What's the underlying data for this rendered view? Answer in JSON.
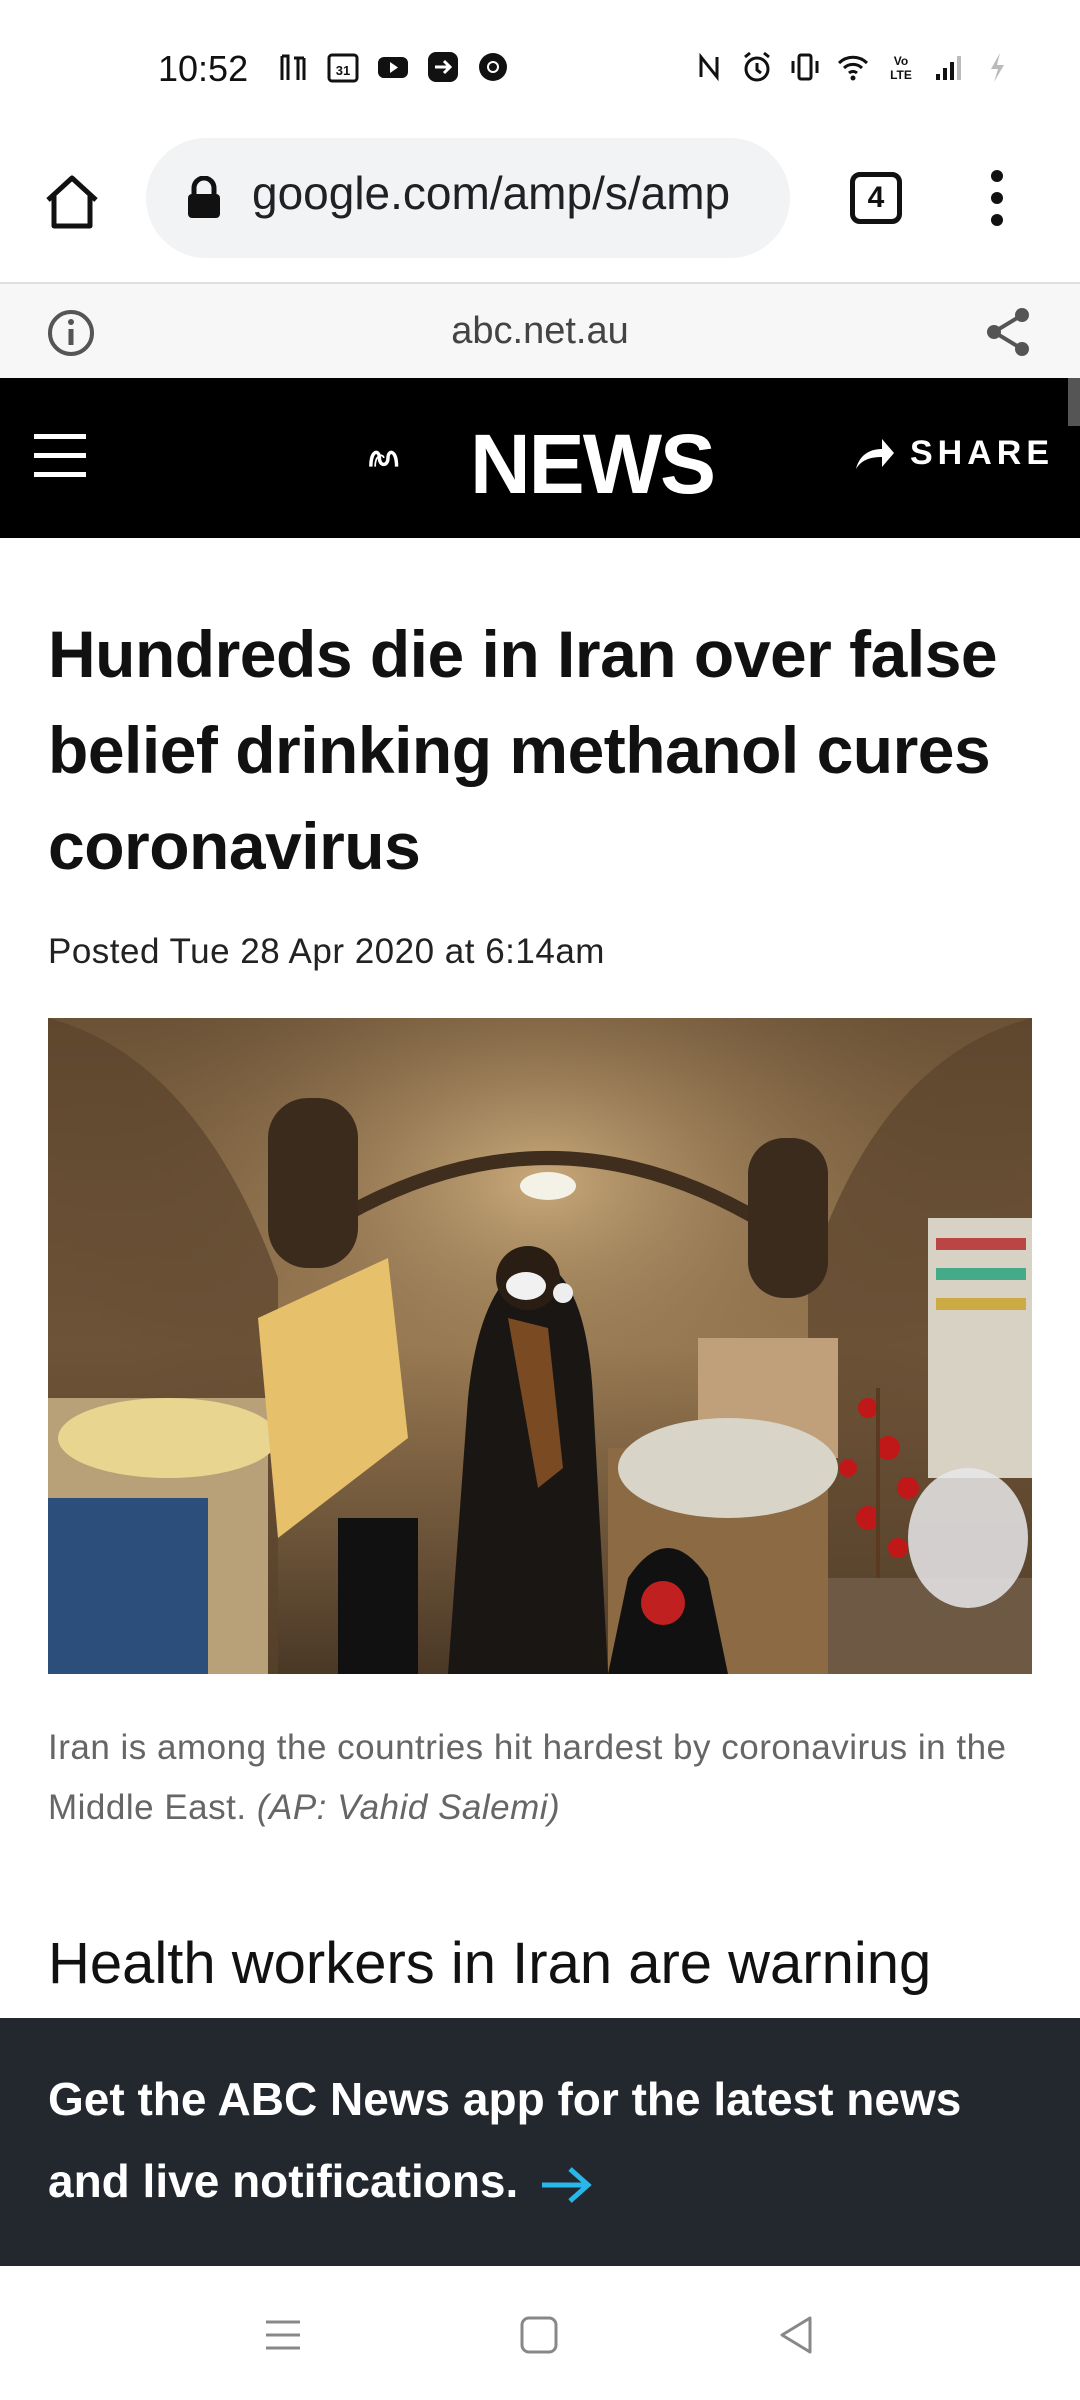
{
  "status_bar": {
    "time": "10:52",
    "left_icons": [
      "data-saver-icon",
      "calendar-icon",
      "youtube-icon",
      "forward-icon",
      "chrome-icon"
    ],
    "right_icons": [
      "nfc-icon",
      "alarm-icon",
      "vibrate-icon",
      "wifi-icon",
      "volte-icon",
      "signal-icon",
      "battery-icon"
    ]
  },
  "browser": {
    "url": "google.com/amp/s/amp",
    "tab_count": "4",
    "site_domain": "abc.net.au"
  },
  "abc_header": {
    "logo_text": "NEWS",
    "share_label": "SHARE"
  },
  "article": {
    "headline": "Hundreds die in Iran over false belief drinking methanol cures coronavirus",
    "posted": "Posted Tue 28 Apr 2020 at 6:14am",
    "caption": "Iran is among the countries hit hardest by coronavirus in the Middle East.",
    "credit": "(AP: Vahid Salemi)",
    "lede": "Health workers in Iran are warning"
  },
  "app_banner": {
    "text": "Get the ABC News app for the latest news and live notifications."
  },
  "colors": {
    "header_bg": "#000000",
    "banner_bg": "#23272e",
    "banner_arrow": "#29b6e8"
  }
}
